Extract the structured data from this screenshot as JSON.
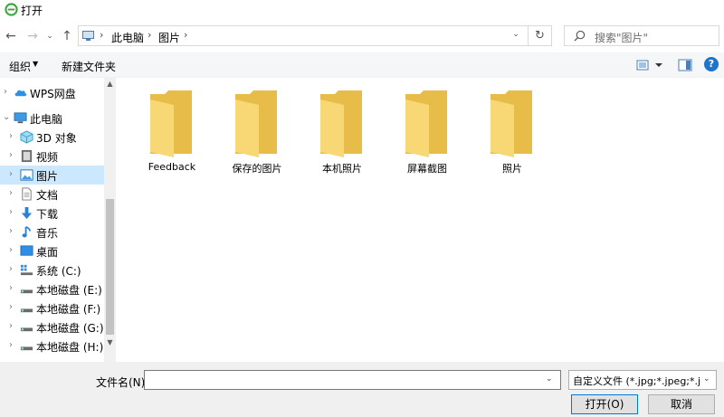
{
  "window": {
    "title": "打开"
  },
  "address": {
    "breadcrumbs": [
      "此电脑",
      "图片"
    ],
    "search_placeholder": "搜索\"图片\""
  },
  "toolbar": {
    "organize_label": "组织",
    "new_folder_label": "新建文件夹"
  },
  "nav": {
    "items": [
      {
        "label": "WPS网盘",
        "icon": "cloud-icon"
      },
      {
        "label": "此电脑",
        "icon": "computer-icon"
      },
      {
        "label": "3D 对象",
        "icon": "cube-3d-icon"
      },
      {
        "label": "视频",
        "icon": "video-icon"
      },
      {
        "label": "图片",
        "icon": "pictures-icon",
        "selected": true
      },
      {
        "label": "文档",
        "icon": "document-icon"
      },
      {
        "label": "下载",
        "icon": "download-arrow-icon"
      },
      {
        "label": "音乐",
        "icon": "music-note-icon"
      },
      {
        "label": "桌面",
        "icon": "desktop-icon"
      },
      {
        "label": "系统 (C:)",
        "icon": "system-drive-icon"
      },
      {
        "label": "本地磁盘 (E:)",
        "icon": "drive-icon"
      },
      {
        "label": "本地磁盘 (F:)",
        "icon": "drive-icon"
      },
      {
        "label": "本地磁盘 (G:)",
        "icon": "drive-icon"
      },
      {
        "label": "本地磁盘 (H:)",
        "icon": "drive-icon"
      }
    ]
  },
  "content": {
    "folders": [
      {
        "name": "Feedback"
      },
      {
        "name": "保存的图片"
      },
      {
        "name": "本机照片"
      },
      {
        "name": "屏幕截图"
      },
      {
        "name": "照片"
      }
    ]
  },
  "bottom": {
    "filename_label": "文件名(N):",
    "filename_value": "",
    "filetype_value": "自定义文件 (*.jpg;*.jpeg;*.jpe;",
    "open_label": "打开(O)",
    "cancel_label": "取消"
  },
  "colors": {
    "folder": "#f8d775",
    "folder_dark": "#e8bc48",
    "selected": "#cce8ff",
    "accent": "#0078d7"
  }
}
